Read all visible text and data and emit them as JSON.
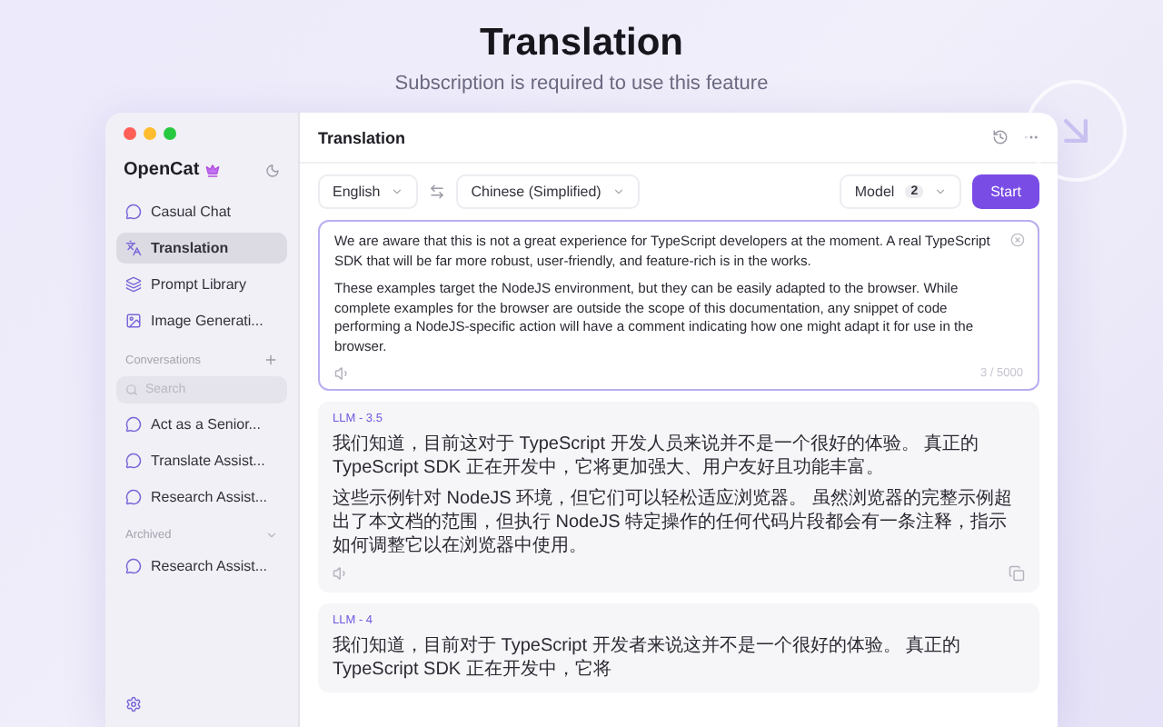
{
  "hero": {
    "title": "Translation",
    "subtitle": "Subscription is required to use this feature"
  },
  "sidebar": {
    "app_name": "OpenCat",
    "nav": [
      {
        "label": "Casual Chat",
        "kind": "chat",
        "selected": false
      },
      {
        "label": "Translation",
        "kind": "translate",
        "selected": true
      },
      {
        "label": "Prompt Library",
        "kind": "library",
        "selected": false
      },
      {
        "label": "Image Generati...",
        "kind": "image",
        "selected": false
      }
    ],
    "conversations_label": "Conversations",
    "search": {
      "placeholder": "Search"
    },
    "conversations": [
      {
        "label": "Act as a Senior..."
      },
      {
        "label": "Translate Assist..."
      },
      {
        "label": "Research Assist..."
      }
    ],
    "archived_label": "Archived",
    "archived": [
      {
        "label": "Research Assist..."
      }
    ]
  },
  "main": {
    "title": "Translation",
    "source_language": "English",
    "target_language": "Chinese (Simplified)",
    "model_label": "Model",
    "model_count": "2",
    "start_button": "Start",
    "input": {
      "paragraphs": [
        "We are aware that this is not a great experience for TypeScript developers at the moment. A real TypeScript SDK that will be far more robust, user-friendly, and feature-rich is in the works.",
        "These examples target the NodeJS environment, but they can be easily adapted to the browser. While complete examples for the browser are outside the scope of this documentation, any snippet of code performing a NodeJS-specific action will have a comment indicating how one might adapt it for use in the browser."
      ],
      "count": "3 / 5000"
    },
    "results": [
      {
        "model": "LLM - 3.5",
        "paragraphs": [
          "我们知道，目前这对于 TypeScript 开发人员来说并不是一个很好的体验。 真正的 TypeScript SDK 正在开发中，它将更加强大、用户友好且功能丰富。",
          "这些示例针对 NodeJS 环境，但它们可以轻松适应浏览器。 虽然浏览器的完整示例超出了本文档的范围，但执行 NodeJS 特定操作的任何代码片段都会有一条注释，指示如何调整它以在浏览器中使用。"
        ]
      },
      {
        "model": "LLM - 4",
        "paragraphs": [
          "我们知道，目前对于 TypeScript 开发者来说这并不是一个很好的体验。 真正的 TypeScript SDK 正在开发中，它将"
        ]
      }
    ]
  }
}
